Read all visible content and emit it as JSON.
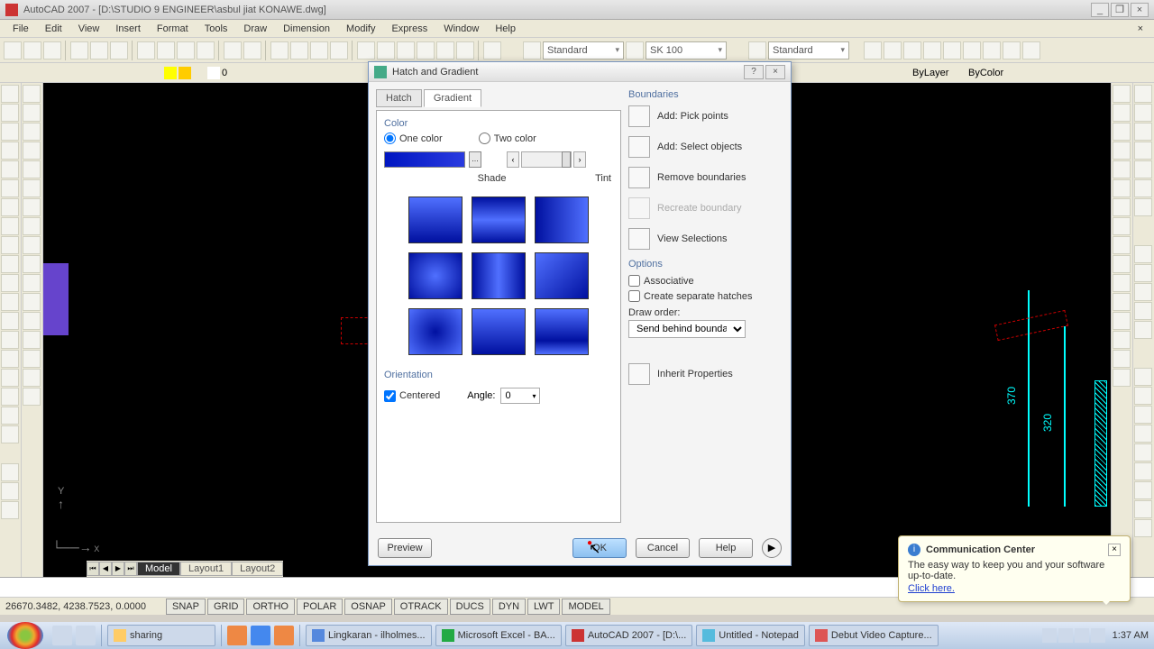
{
  "window": {
    "title": "AutoCAD 2007 - [D:\\STUDIO 9 ENGINEER\\asbul jiat KONAWE.dwg]"
  },
  "menu": [
    "File",
    "Edit",
    "View",
    "Insert",
    "Format",
    "Tools",
    "Draw",
    "Dimension",
    "Modify",
    "Express",
    "Window",
    "Help"
  ],
  "props_toolbar": {
    "style1": "Standard",
    "style2": "SK 100",
    "style3": "Standard"
  },
  "layer_toolbar": {
    "layer_combo": "0",
    "linetype": "ByLayer",
    "lineweight": "ByColor"
  },
  "dialog": {
    "title": "Hatch and Gradient",
    "tabs": {
      "hatch": "Hatch",
      "gradient": "Gradient"
    },
    "color": {
      "label": "Color",
      "one": "One color",
      "two": "Two color",
      "shade": "Shade",
      "tint": "Tint"
    },
    "orientation": {
      "label": "Orientation",
      "centered": "Centered",
      "angle_label": "Angle:",
      "angle_value": "0"
    },
    "boundaries": {
      "label": "Boundaries",
      "pick": "Add: Pick points",
      "select": "Add: Select objects",
      "remove": "Remove boundaries",
      "recreate": "Recreate boundary",
      "view": "View Selections"
    },
    "options": {
      "label": "Options",
      "assoc": "Associative",
      "separate": "Create separate hatches",
      "draw_order_label": "Draw order:",
      "draw_order": "Send behind boundary"
    },
    "inherit": "Inherit Properties",
    "buttons": {
      "preview": "Preview",
      "ok": "OK",
      "cancel": "Cancel",
      "help": "Help"
    }
  },
  "canvas": {
    "dim1": "370",
    "dim2": "320"
  },
  "model_tabs": {
    "model": "Model",
    "l1": "Layout1",
    "l2": "Layout2"
  },
  "status": {
    "coords": "26670.3482, 4238.7523, 0.0000",
    "buttons": [
      "SNAP",
      "GRID",
      "ORTHO",
      "POLAR",
      "OSNAP",
      "OTRACK",
      "DUCS",
      "DYN",
      "LWT",
      "MODEL"
    ]
  },
  "comm": {
    "title": "Communication Center",
    "msg": "The easy way to keep you and your software up-to-date.",
    "link": "Click here."
  },
  "taskbar": {
    "tasks": [
      "sharing",
      "Lingkaran - ilholmes...",
      "Microsoft Excel - BA...",
      "AutoCAD 2007 - [D:\\...",
      "Untitled - Notepad",
      "Debut Video Capture..."
    ],
    "time": "1:37 AM"
  }
}
